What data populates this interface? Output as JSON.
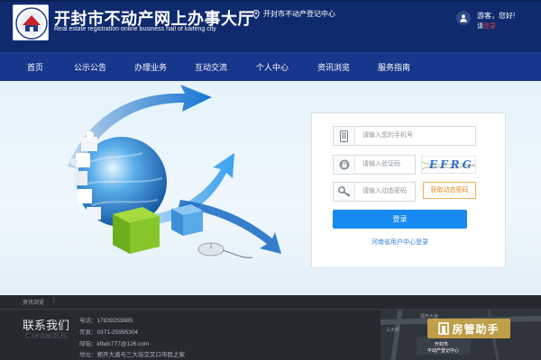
{
  "header": {
    "title_cn": "开封市不动产网上办事大厅",
    "title_en": "Real estate registration online business hall of kaifeng city",
    "location": "开封市不动产登记中心",
    "greeting": "游客，您好!",
    "login_prefix": "请",
    "login_link": "登录"
  },
  "nav": {
    "items": [
      "首页",
      "公示公告",
      "办理业务",
      "互动交流",
      "个人中心",
      "资讯浏览",
      "服务指南"
    ]
  },
  "login_form": {
    "phone_placeholder": "请输入您的手机号",
    "captcha_placeholder": "请输入验证码",
    "captcha_text": "EFRG",
    "dynamic_placeholder": "请输入动态密码",
    "get_code_label": "获取动态密码",
    "submit_label": "登录",
    "provincial_link": "河南省用户中心登录"
  },
  "footer": {
    "tab_label": "资讯浏览",
    "separator": "|",
    "contact_cn": "联系我们",
    "contact_en": "ContactUs",
    "phone_label": "电话：",
    "phone": "17839253885",
    "fax_label": "传真：",
    "fax": "0371-25995304",
    "email_label": "邮箱：",
    "email": "kfbdc777@126.com",
    "address_label": "地址：",
    "address": "郑开大道与三大街交叉口市民之家",
    "map_label_1": "开封市",
    "map_label_2": "不动产登记中心",
    "map_road_1": "三大街",
    "map_road_2": "郑开大道"
  },
  "watermark": {
    "text": "房管助手"
  },
  "colors": {
    "header_bg": "#102a6e",
    "nav_bg": "#17378c",
    "accent_blue": "#1889f0",
    "code_orange": "#e08a1c",
    "footer_bg": "#26292e"
  }
}
